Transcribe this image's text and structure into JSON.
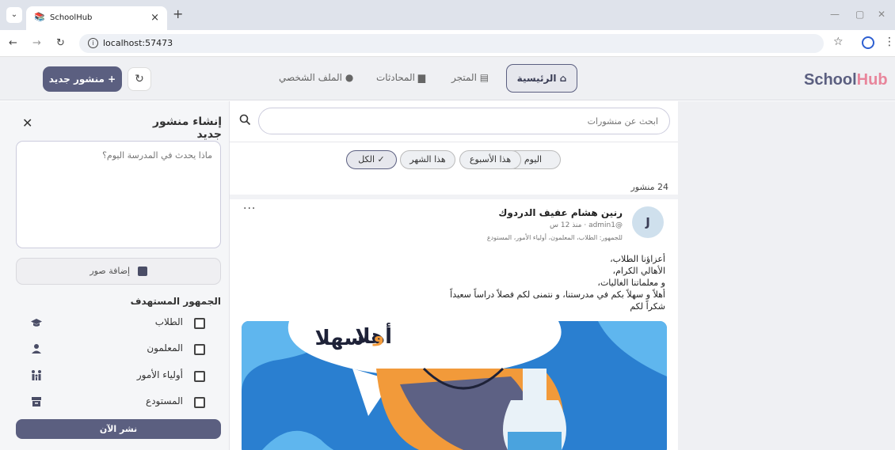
{
  "browser": {
    "tab_title": "SchoolHub",
    "url": "localhost:57473",
    "tab_menu_icon": "chevron-down-icon",
    "new_tab_symbol": "+"
  },
  "app": {
    "logo_part1": "School",
    "logo_part2": "Hub",
    "colors": {
      "primary": "#5b5f80",
      "accent": "#e8859b",
      "header_bg": "#eff0f3"
    },
    "nav": {
      "home": "الرئيسية",
      "store": "المتجر",
      "chats": "المحادثات",
      "profile": "الملف الشخصي"
    },
    "new_post_button": "منشور جديد"
  },
  "composer": {
    "title": "إنشاء منشور جديد",
    "placeholder": "ماذا يحدث في المدرسة اليوم؟",
    "add_photos": "إضافة صور",
    "audience_title": "الجمهور المستهدف",
    "audience": [
      {
        "label": "الطلاب",
        "icon": "graduation-cap-icon"
      },
      {
        "label": "المعلمون",
        "icon": "person-icon"
      },
      {
        "label": "أولياء الأمور",
        "icon": "family-icon"
      },
      {
        "label": "المستودع",
        "icon": "archive-icon"
      }
    ],
    "publish": "نشر الآن"
  },
  "feed": {
    "search_placeholder": "ابحث عن منشورات",
    "filters": [
      "اليوم",
      "هذا الأسبوع",
      "هذا الشهر",
      "الكل"
    ],
    "active_filter": "الكل",
    "count": "24 منشور",
    "post": {
      "avatar_letter": "J",
      "author": "رنين هشام عفيف الدردوك",
      "meta": "@admin1 · منذ 12 س",
      "audience": "للجمهور: الطلاب، المعلمون، أولياء الأمور، المستودع",
      "body": [
        "أعزاؤنا الطلاب،",
        "الأهالي الكرام،",
        "و معلماتنا الغاليات،",
        "أهلاً و سهلاً بكم في مدرستنا، و نتمنى لكم فصلاً دراساً سعيداً",
        "شكراً لكم"
      ],
      "image_text_1": "أهلا",
      "image_text_2": "و",
      "image_text_3": "سهلا"
    }
  }
}
